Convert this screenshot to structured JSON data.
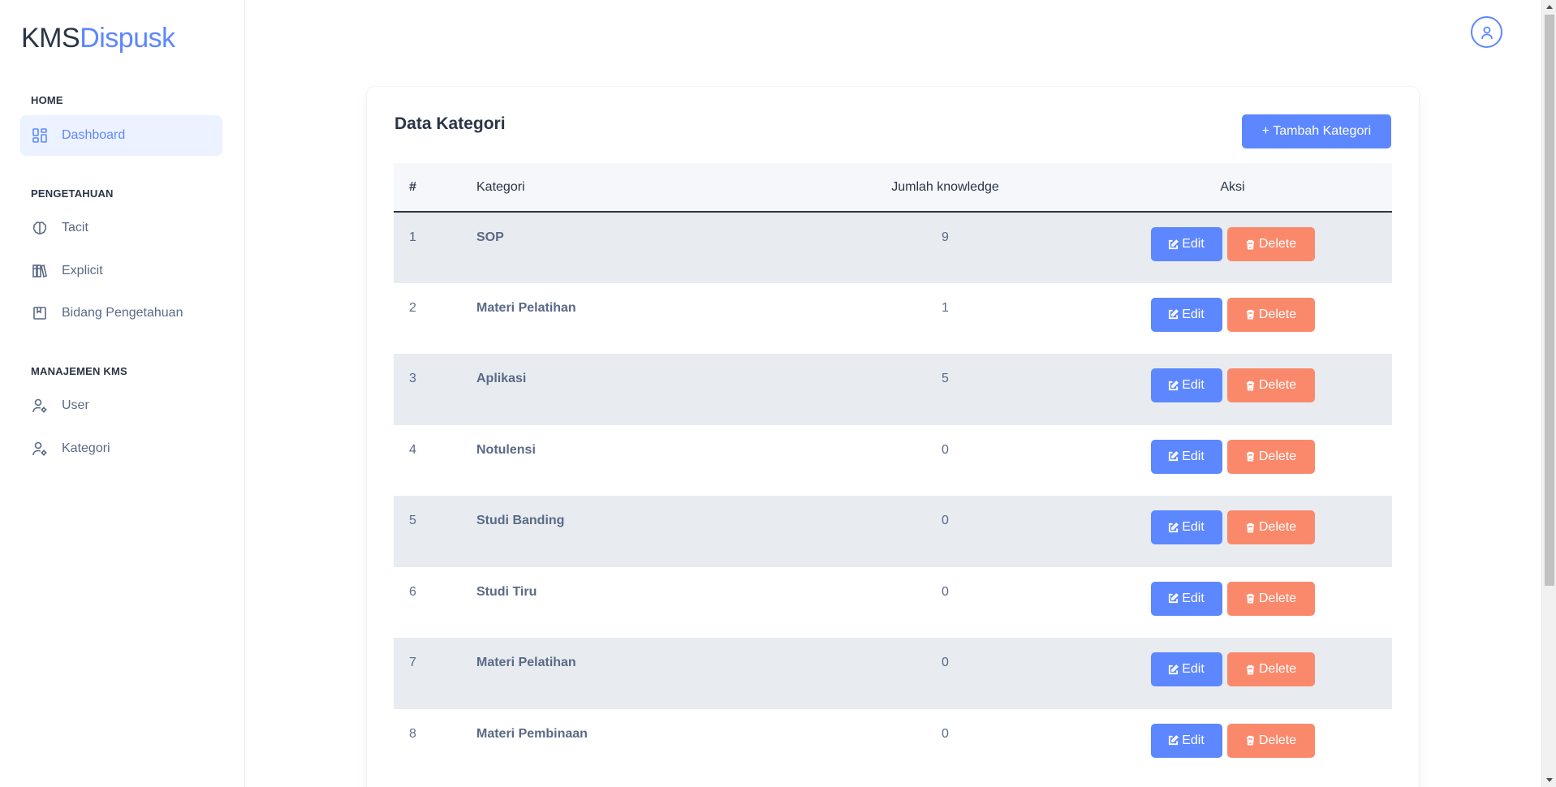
{
  "brand": {
    "part1": "KMS",
    "part2": "Dispusk"
  },
  "sidebar": {
    "sections": [
      {
        "caption": "HOME"
      },
      {
        "caption": "PENGETAHUAN"
      },
      {
        "caption": "MANAJEMEN KMS"
      }
    ],
    "items": [
      {
        "label": "Dashboard",
        "icon": "dashboard-icon"
      },
      {
        "label": "Tacit",
        "icon": "brain-icon"
      },
      {
        "label": "Explicit",
        "icon": "books-icon"
      },
      {
        "label": "Bidang Pengetahuan",
        "icon": "bookmark-icon"
      },
      {
        "label": "User",
        "icon": "user-settings-icon"
      },
      {
        "label": "Kategori",
        "icon": "user-settings-icon"
      }
    ]
  },
  "header": {
    "avatar_icon": "user-icon"
  },
  "card": {
    "title": "Data Kategori",
    "add_button": "+ Tambah Kategori"
  },
  "table": {
    "headers": [
      "#",
      "Kategori",
      "Jumlah knowledge",
      "Aksi"
    ],
    "rows": [
      {
        "no": "1",
        "kategori": "SOP",
        "jumlah": "9"
      },
      {
        "no": "2",
        "kategori": "Materi Pelatihan",
        "jumlah": "1"
      },
      {
        "no": "3",
        "kategori": "Aplikasi",
        "jumlah": "5"
      },
      {
        "no": "4",
        "kategori": "Notulensi",
        "jumlah": "0"
      },
      {
        "no": "5",
        "kategori": "Studi Banding",
        "jumlah": "0"
      },
      {
        "no": "6",
        "kategori": "Studi Tiru",
        "jumlah": "0"
      },
      {
        "no": "7",
        "kategori": "Materi Pelatihan",
        "jumlah": "0"
      },
      {
        "no": "8",
        "kategori": "Materi Pembinaan",
        "jumlah": "0"
      }
    ],
    "edit_label": "Edit",
    "delete_label": "Delete"
  },
  "colors": {
    "primary": "#5d87ff",
    "danger": "#fa896b",
    "text": "#2a3547",
    "muted": "#5a6a85",
    "row_alt": "#e8ecf1"
  }
}
